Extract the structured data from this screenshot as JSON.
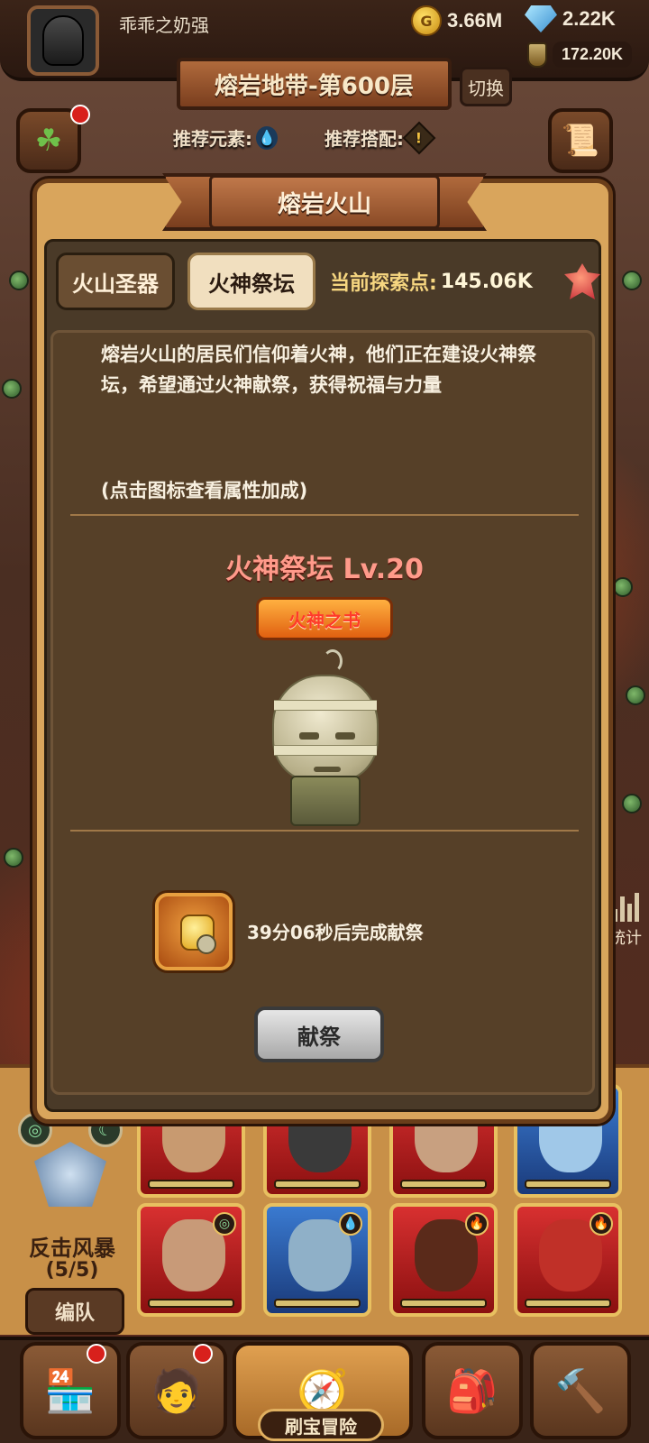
{
  "player": {
    "name": "乖乖之奶强",
    "gold": "3.66M",
    "gems": "2.22K",
    "potion": "172.20K"
  },
  "stage": {
    "title": "熔岩地带-第600层",
    "switch_label": "切换",
    "recommend_element_label": "推荐元素:",
    "recommend_combo_label": "推荐搭配:"
  },
  "modal": {
    "title": "熔岩火山",
    "tabs": [
      {
        "label": "火山圣器",
        "selected": false
      },
      {
        "label": "火神祭坛",
        "selected": true
      }
    ],
    "points_label": "当前探索点:",
    "points_value": "145.06K",
    "description": "熔岩火山的居民们信仰着火神，他们正在建设火神祭坛，希望通过火神献祭，获得祝福与力量",
    "hint": "(点击图标查看属性加成)",
    "altar_title": "火神祭坛 Lv.20",
    "book_button": "火神之书",
    "timer_text": "39分06秒后完成献祭",
    "sacrifice_button": "献祭"
  },
  "side": {
    "stats_label": "统计"
  },
  "team": {
    "name": "反击风暴",
    "count": "(5/5)",
    "formation_button": "编队"
  },
  "nav": {
    "active_label": "刷宝冒险"
  },
  "icons": {
    "gold": "coin-icon",
    "gems": "gem-icon",
    "potion": "potion-icon",
    "element": "water-drop-icon",
    "combo": "warning-icon",
    "points": "crystal-icon"
  },
  "colors": {
    "altar_title": "#ff9a8a",
    "points_label": "#f6d680",
    "book_button": "#ff7a20",
    "modal_frame": "#d9a55c"
  }
}
